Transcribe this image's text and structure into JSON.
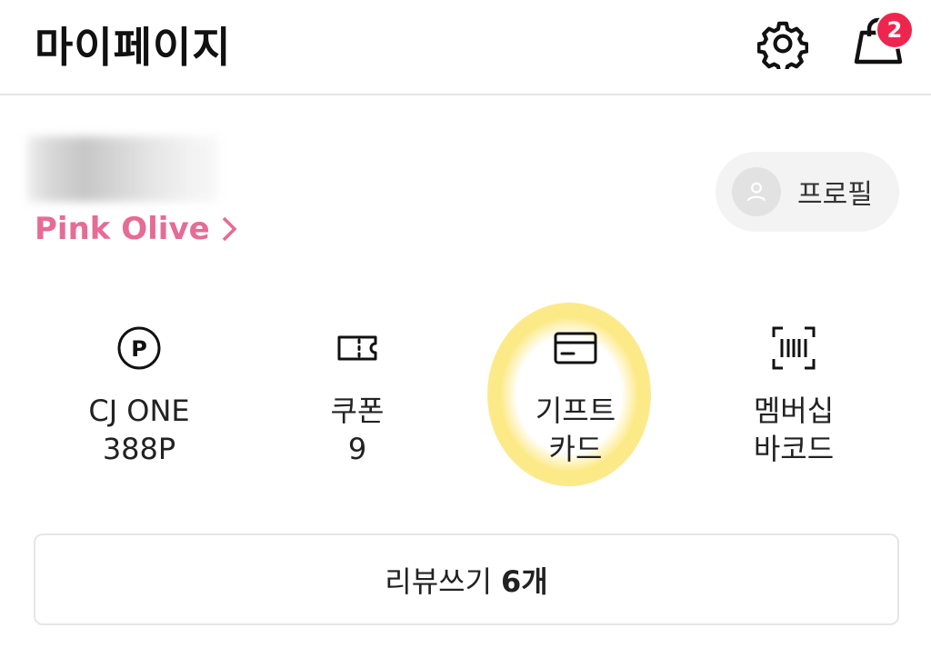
{
  "header": {
    "title": "마이페이지",
    "cart_badge_count": "2",
    "icons": [
      "gear-icon",
      "shopping-bag-icon"
    ]
  },
  "user": {
    "grade": "Pink Olive",
    "profile_label": "프로필",
    "grade_color": "#e66b95"
  },
  "menu": [
    {
      "icon": "point-icon",
      "label": "CJ ONE\n388P"
    },
    {
      "icon": "coupon-icon",
      "label": "쿠폰\n9"
    },
    {
      "icon": "gift-card-icon",
      "label": "기프트\n카드"
    },
    {
      "icon": "barcode-icon",
      "label": "멤버십\n바코드"
    }
  ],
  "review": {
    "label": "리뷰쓰기",
    "count": "6개"
  },
  "colors": {
    "badge": "#f0254f",
    "highlight": "#fce778"
  }
}
